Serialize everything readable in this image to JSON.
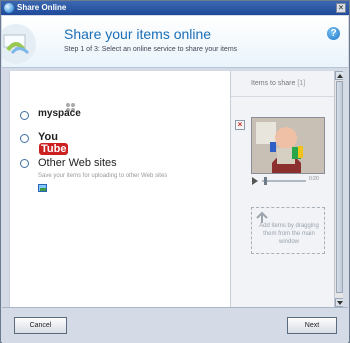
{
  "window": {
    "title": "Share Online"
  },
  "header": {
    "title": "Share your items online",
    "subtitle": "Step 1 of 3: Select an online service to share your items"
  },
  "services": [
    {
      "name": "myspace",
      "type": "logo"
    },
    {
      "name": "YouTube",
      "type": "logo"
    },
    {
      "name": "Other Web sites",
      "type": "text"
    }
  ],
  "other_web_sites": {
    "description": "Save your items for uploading to other Web sites"
  },
  "items_panel": {
    "title": "Items to share",
    "count": "[1]",
    "player_time": "0:20",
    "drop_hint": "Add items by dragging them from the main window"
  },
  "footer": {
    "cancel_label": "Cancel",
    "next_label": "Next"
  },
  "colors": {
    "accent": "#1a6fb8",
    "title_bar": "#1f4a9a",
    "youtube_red": "#cc1f1f"
  },
  "icons": {
    "app": "share-online-icon",
    "help": "help-icon",
    "close": "close-icon",
    "remove": "remove-item-icon",
    "drop": "drag-drop-icon"
  }
}
